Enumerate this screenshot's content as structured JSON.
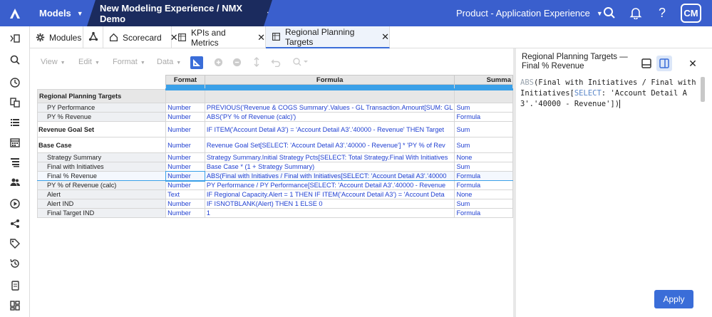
{
  "topbar": {
    "models_label": "Models",
    "model_name": "New Modeling Experience / NMX Demo",
    "product_label": "Product - Application Experience",
    "avatar_initials": "CM",
    "bg_color": "#3a5fcd"
  },
  "tabs": [
    {
      "label": "Modules",
      "icon": "modules-gear-icon"
    },
    {
      "label": "",
      "icon": "anaplan-logo-icon"
    },
    {
      "label": "Scorecard",
      "icon": "home-icon"
    },
    {
      "label": "KPIs and Metrics",
      "icon": "grid-icon"
    },
    {
      "label": "Regional Planning Targets",
      "icon": "grid-icon",
      "active": true
    }
  ],
  "toolbar": {
    "view": "View",
    "edit": "Edit",
    "format": "Format",
    "data": "Data"
  },
  "grid": {
    "headers": [
      "Format",
      "Formula",
      "Summa"
    ],
    "rows": [
      {
        "type": "section",
        "label": "Regional Planning Targets",
        "format": "",
        "formula": "",
        "summary": ""
      },
      {
        "type": "row",
        "label": "PY Performance",
        "format": "Number",
        "formula": "PREVIOUS('Revenue & COGS Summary'.Values - GL Transaction.Amount[SUM: GL",
        "summary": "Sum"
      },
      {
        "type": "row",
        "label": "PY % Revenue",
        "format": "Number",
        "formula": "ABS('PY % of Revenue (calc)')",
        "summary": "Formula"
      },
      {
        "type": "tall-bold",
        "label": "Revenue Goal Set",
        "format": "Number",
        "formula": "IF ITEM('Account Detail A3') = 'Account Detail A3'.'40000 - Revenue' THEN Target",
        "summary": "Sum"
      },
      {
        "type": "tall-bold",
        "label": "Base Case",
        "format": "Number",
        "formula": "Revenue Goal Set[SELECT: 'Account Detail A3'.'40000 - Revenue'] * 'PY % of Rev",
        "summary": "Sum"
      },
      {
        "type": "row",
        "label": "Strategy Summary",
        "format": "Number",
        "formula": "Strategy Summary.Initial Strategy Pcts[SELECT: Total Strategy.Final With Initiatives",
        "summary": "None"
      },
      {
        "type": "row",
        "label": "Final with Initiatives",
        "format": "Number",
        "formula": "Base Case * (1 + Strategy Summary)",
        "summary": "Sum"
      },
      {
        "type": "selected",
        "label": "Final % Revenue",
        "format": "Number",
        "formula": "ABS(Final with Initiatives / Final with Initiatives[SELECT: 'Account Detail A3'.'40000",
        "summary": "Formula"
      },
      {
        "type": "row",
        "label": "PY % of Revenue (calc)",
        "format": "Number",
        "formula": "PY Performance / PY Performance[SELECT: 'Account Detail A3'.'40000 - Revenue",
        "summary": "Formula"
      },
      {
        "type": "row",
        "label": "Alert",
        "format": "Text",
        "formula": "IF Regional Capacity.Alert = 1 THEN IF ITEM('Account Detail A3') = 'Account Deta",
        "summary": "None"
      },
      {
        "type": "row",
        "label": "Alert IND",
        "format": "Number",
        "formula": "IF ISNOTBLANK(Alert) THEN 1 ELSE 0",
        "summary": "Sum"
      },
      {
        "type": "row",
        "label": "Final Target IND",
        "format": "Number",
        "formula": "1",
        "summary": "Formula"
      }
    ]
  },
  "panel": {
    "title": "Regional Planning Targets — Final % Revenue",
    "code_fn": "ABS",
    "code_part1": "(Final with Initiatives / Final with Initiatives[",
    "code_kw": "SELECT",
    "code_part2": ": 'Account Detail A3'.'40000 - Revenue'])",
    "apply_label": "Apply"
  }
}
